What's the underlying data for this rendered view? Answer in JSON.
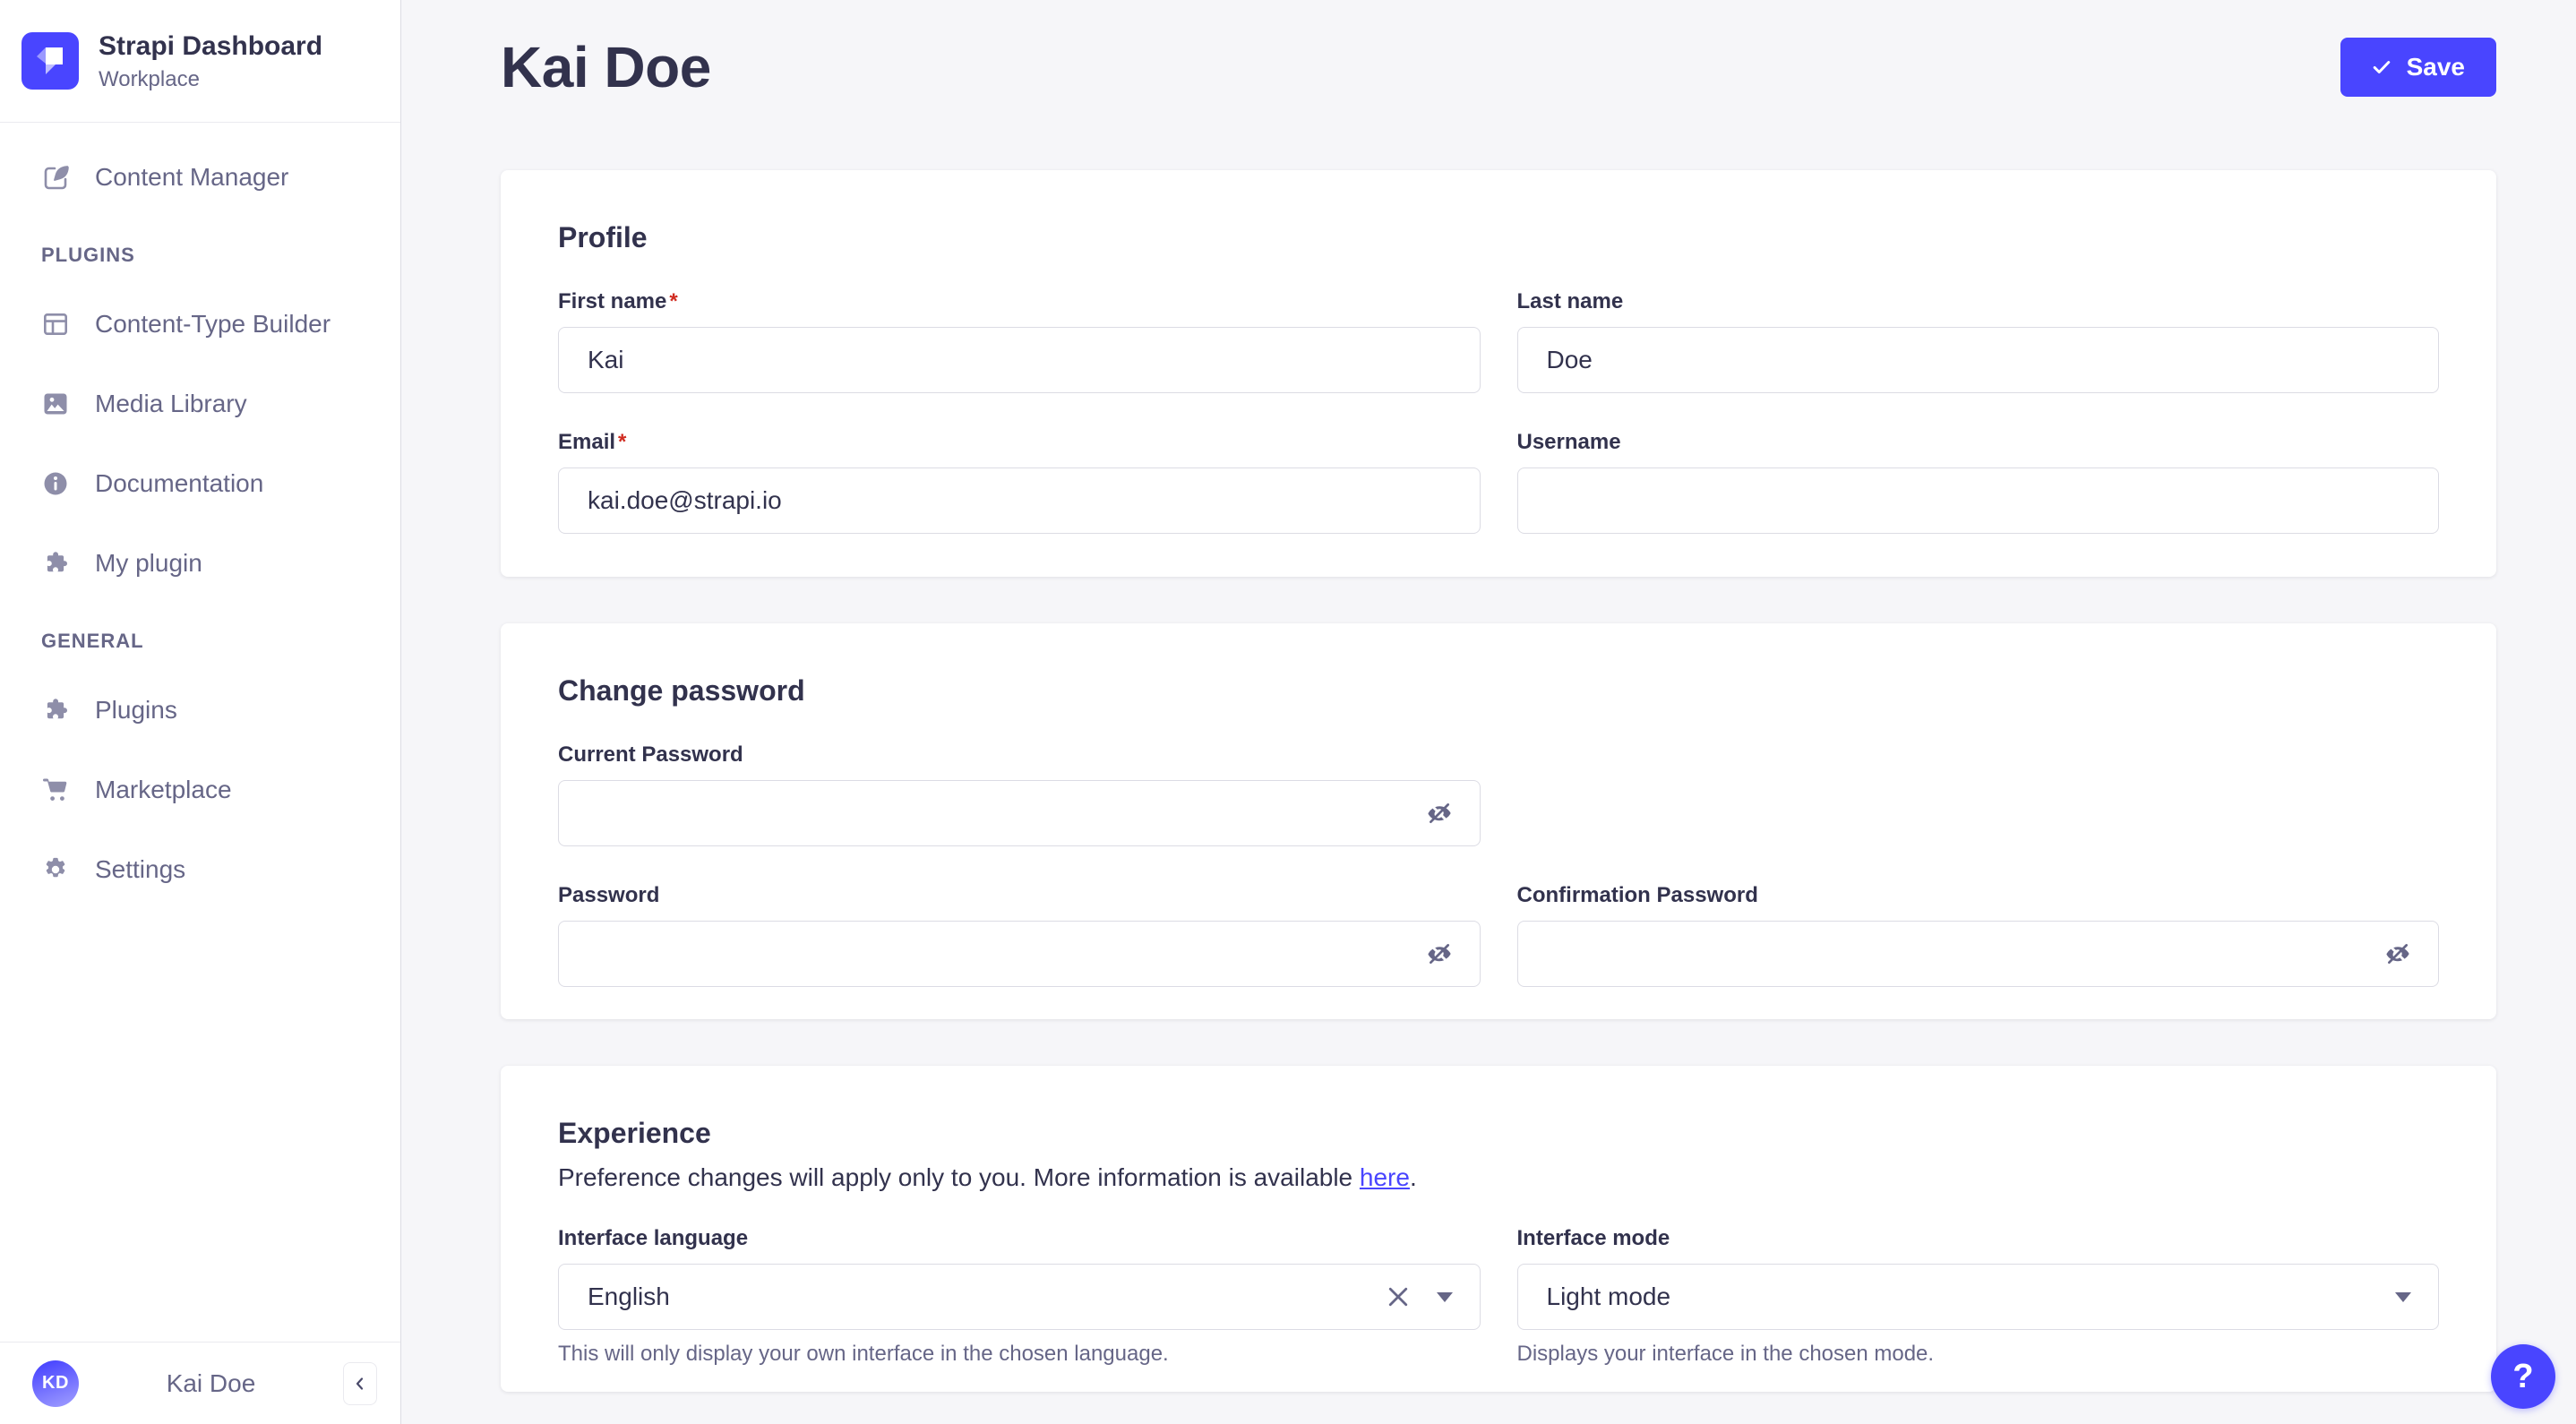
{
  "app": {
    "title": "Strapi Dashboard",
    "subtitle": "Workplace"
  },
  "sidebar": {
    "nav": {
      "content_manager": "Content Manager",
      "plugins_section": "PLUGINS",
      "content_type_builder": "Content-Type Builder",
      "media_library": "Media Library",
      "documentation": "Documentation",
      "my_plugin": "My plugin",
      "general_section": "GENERAL",
      "plugins": "Plugins",
      "marketplace": "Marketplace",
      "settings": "Settings"
    },
    "footer": {
      "user_name": "Kai Doe",
      "user_initials": "KD"
    }
  },
  "header": {
    "page_title": "Kai Doe",
    "save_button": "Save"
  },
  "profile": {
    "title": "Profile",
    "required_mark": "*",
    "first_name_label": "First name",
    "first_name_value": "Kai",
    "last_name_label": "Last name",
    "last_name_value": "Doe",
    "email_label": "Email",
    "email_value": "kai.doe@strapi.io",
    "username_label": "Username",
    "username_value": ""
  },
  "password": {
    "title": "Change password",
    "current_label": "Current Password",
    "new_label": "Password",
    "confirmation_label": "Confirmation Password"
  },
  "experience": {
    "title": "Experience",
    "desc_prefix": "Preference changes will apply only to you. More information is available ",
    "link_text": "here",
    "desc_suffix": ".",
    "language_label": "Interface language",
    "language_value": "English",
    "language_hint": "This will only display your own interface in the chosen language.",
    "mode_label": "Interface mode",
    "mode_value": "Light mode",
    "mode_hint": "Displays your interface in the chosen mode."
  },
  "help": {
    "label": "?"
  },
  "colors": {
    "primary": "#4945ff",
    "danger": "#d02b20",
    "text": "#32324d",
    "muted": "#666687",
    "icon": "#8e8ea9",
    "border": "#dcdce4",
    "background": "#f6f6f9"
  }
}
